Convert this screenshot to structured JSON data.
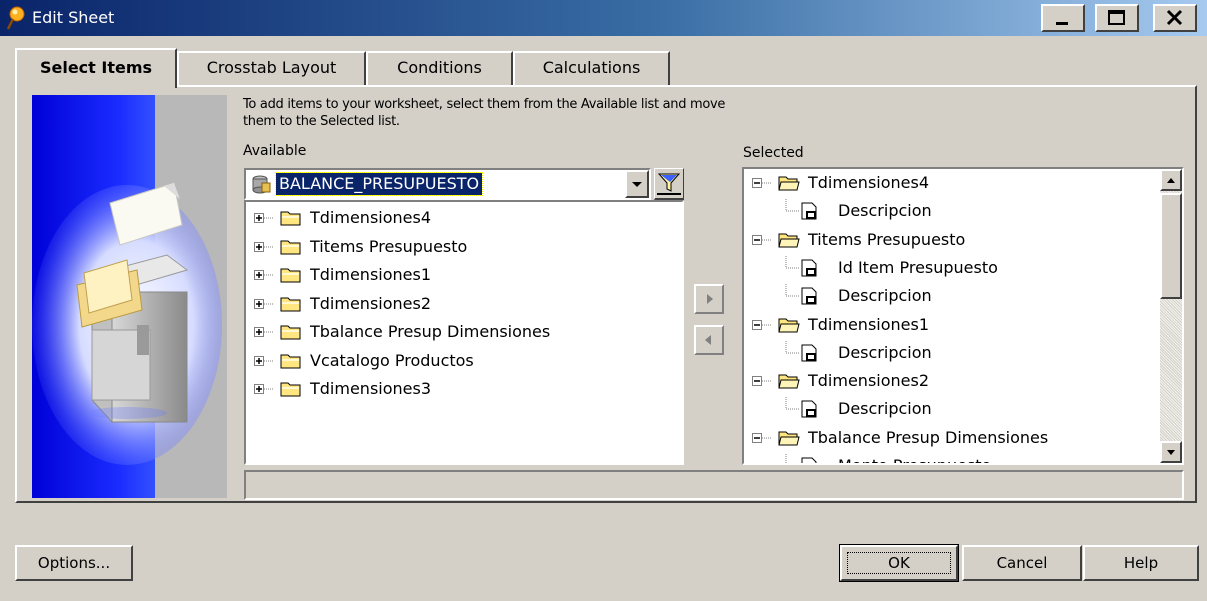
{
  "window": {
    "title": "Edit Sheet",
    "icon": "discoverer-pin-icon",
    "controls": [
      "minimize",
      "maximize",
      "close"
    ]
  },
  "tabs": [
    {
      "label": "Select Items",
      "active": true
    },
    {
      "label": "Crosstab Layout",
      "active": false
    },
    {
      "label": "Conditions",
      "active": false
    },
    {
      "label": "Calculations",
      "active": false
    }
  ],
  "instructions": {
    "line1": "To add items to your worksheet, select them from the Available list and move",
    "line2": "them to the Selected list."
  },
  "available": {
    "label": "Available",
    "business_area": "BALANCE_PRESUPUESTO",
    "folders": [
      "Tdimensiones4",
      "Titems Presupuesto",
      "Tdimensiones1",
      "Tdimensiones2",
      "Tbalance Presup Dimensiones",
      "Vcatalogo Productos",
      "Tdimensiones3"
    ]
  },
  "selected": {
    "label": "Selected",
    "rows": [
      {
        "type": "folder",
        "text": "Tdimensiones4"
      },
      {
        "type": "item",
        "text": "Descripcion"
      },
      {
        "type": "folder",
        "text": "Titems Presupuesto"
      },
      {
        "type": "item",
        "text": "Id Item Presupuesto"
      },
      {
        "type": "item",
        "text": "Descripcion"
      },
      {
        "type": "folder",
        "text": "Tdimensiones1"
      },
      {
        "type": "item",
        "text": "Descripcion"
      },
      {
        "type": "folder",
        "text": "Tdimensiones2"
      },
      {
        "type": "item",
        "text": "Descripcion"
      },
      {
        "type": "folder",
        "text": "Tbalance Presup Dimensiones"
      },
      {
        "type": "item",
        "text": "Monto Presupuesto"
      }
    ]
  },
  "buttons": {
    "options": "Options...",
    "ok": "OK",
    "cancel": "Cancel",
    "help": "Help"
  },
  "colors": {
    "title_bar": "#0a246a",
    "dialog_bg": "#d4d0c8",
    "selection": "#0a246a",
    "folder_yellow": "#ffe680"
  }
}
